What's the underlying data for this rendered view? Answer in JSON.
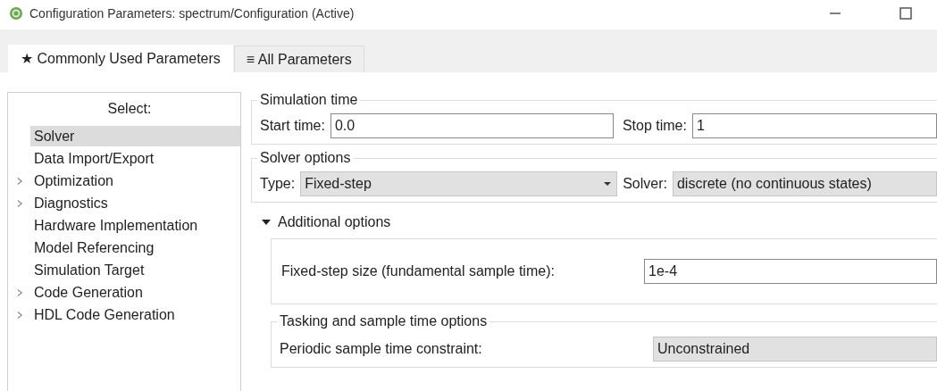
{
  "window": {
    "title": "Configuration Parameters: spectrum/Configuration (Active)"
  },
  "tabs": [
    {
      "label": "★ Commonly Used Parameters",
      "selected": true
    },
    {
      "label": "≡ All Parameters",
      "selected": false
    }
  ],
  "sidebar": {
    "header": "Select:",
    "items": [
      {
        "label": "Solver",
        "selected": true,
        "expandable": false
      },
      {
        "label": "Data Import/Export",
        "selected": false,
        "expandable": false
      },
      {
        "label": "Optimization",
        "selected": false,
        "expandable": true
      },
      {
        "label": "Diagnostics",
        "selected": false,
        "expandable": true
      },
      {
        "label": "Hardware Implementation",
        "selected": false,
        "expandable": false
      },
      {
        "label": "Model Referencing",
        "selected": false,
        "expandable": false
      },
      {
        "label": "Simulation Target",
        "selected": false,
        "expandable": false
      },
      {
        "label": "Code Generation",
        "selected": false,
        "expandable": true
      },
      {
        "label": "HDL Code Generation",
        "selected": false,
        "expandable": true
      }
    ]
  },
  "simulation_time": {
    "title": "Simulation time",
    "start_label": "Start time:",
    "start_value": "0.0",
    "stop_label": "Stop time:",
    "stop_value": "1"
  },
  "solver_options": {
    "title": "Solver options",
    "type_label": "Type:",
    "type_value": "Fixed-step",
    "solver_label": "Solver:",
    "solver_value": "discrete (no continuous states)"
  },
  "additional_options": {
    "title": "Additional options",
    "expanded": true,
    "step_label": "Fixed-step size (fundamental sample time):",
    "step_value": "1e-4",
    "tasking": {
      "title": "Tasking and sample time options",
      "constraint_label": "Periodic sample time constraint:",
      "constraint_value": "Unconstrained"
    }
  }
}
